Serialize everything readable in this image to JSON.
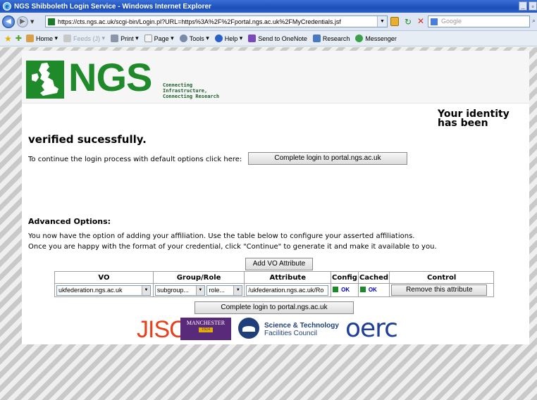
{
  "window": {
    "title": "NGS Shibboleth Login Service - Windows Internet Explorer"
  },
  "address_bar": {
    "url": "https://cts.ngs.ac.uk/scgi-bin/Login.pl?URL=https%3A%2F%2Fportal.ngs.ac.uk%2FMyCredentials.jsf",
    "search_placeholder": "Google"
  },
  "command_bar": {
    "items": [
      {
        "label": "Home",
        "icon": "home-icon",
        "enabled": true
      },
      {
        "label": "Feeds (J)",
        "icon": "feeds-icon",
        "enabled": false
      },
      {
        "label": "Print",
        "icon": "print-icon",
        "enabled": true
      },
      {
        "label": "Page",
        "icon": "page-icon",
        "enabled": true
      },
      {
        "label": "Tools",
        "icon": "tools-icon",
        "enabled": true
      },
      {
        "label": "Help",
        "icon": "help-icon",
        "enabled": true
      },
      {
        "label": "Send to OneNote",
        "icon": "onenote-icon",
        "enabled": true
      },
      {
        "label": "Research",
        "icon": "research-icon",
        "enabled": true
      },
      {
        "label": "Messenger",
        "icon": "messenger-icon",
        "enabled": true
      }
    ]
  },
  "header": {
    "logo_text": "NGS",
    "tagline": [
      "Connecting",
      "Infrastructure,",
      "Connecting Research"
    ]
  },
  "main": {
    "identity_line1": "Your identity",
    "identity_line2": "has been",
    "verified": "verified sucessfully.",
    "continue_text": "To continue the login process with default options click here:",
    "complete_login_label": "Complete login to portal.ngs.ac.uk"
  },
  "advanced": {
    "heading": "Advanced Options:",
    "line1": "You now have the option of adding your affiliation. Use the table below to configure your asserted affiliations.",
    "line2": "Once you are happy with the format of your credential, click \"Continue\" to generate it and make it available to you.",
    "add_vo_label": "Add VO Attribute",
    "table": {
      "headers": [
        "VO",
        "Group/Role",
        "Attribute",
        "Config",
        "Cached",
        "Control"
      ],
      "row": {
        "vo": "ukfederation.ngs.ac.uk",
        "group": "subgroup...",
        "role": "role...",
        "attribute": "/ukfederation.ngs.ac.uk/Ro",
        "config": "OK",
        "cached": "OK",
        "remove_label": "Remove this attribute"
      }
    },
    "complete_login_label": "Complete login to portal.ngs.ac.uk"
  },
  "partners": {
    "jisc": "JISC",
    "manchester": "MANCHESTER",
    "manchester_year": "1824",
    "stfc_line1": "Science & Technology",
    "stfc_line2": "Facilities Council",
    "oerc": "oerc"
  },
  "colors": {
    "ngs_green": "#1f8a2a",
    "jisc_red": "#e8401a",
    "manchester_purple": "#5a2a7a",
    "stfc_blue": "#1f3f7a",
    "oerc_blue": "#1f3f9a"
  }
}
